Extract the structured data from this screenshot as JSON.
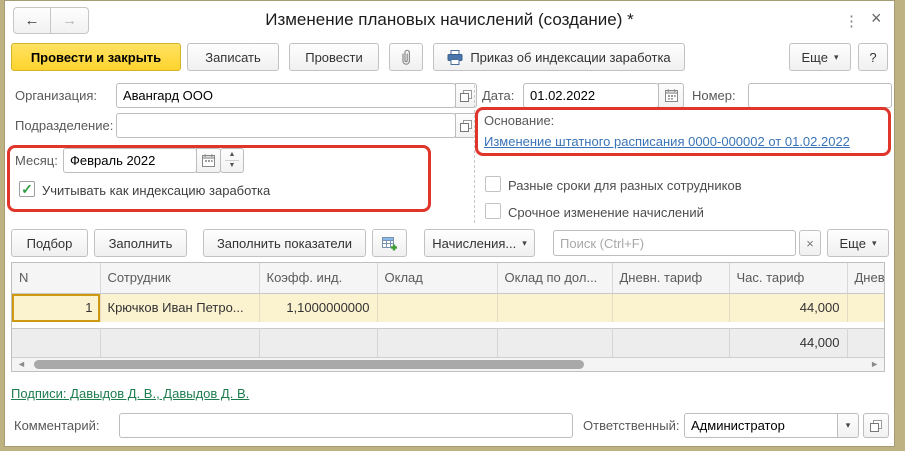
{
  "colors": {
    "accent_yellow": "#ffd42e",
    "annotation_red": "#e0352b",
    "link_blue": "#3a74b8",
    "link_green": "#1d7d4f",
    "row_highlight": "#fbf2cf",
    "selected_cell": "#f5dc6e",
    "desktop_frame": "#bfb282"
  },
  "window": {
    "title": "Изменение плановых начислений (создание) *"
  },
  "icons": {
    "back": "←",
    "forward": "→",
    "menu": "⋮",
    "close": "×",
    "dropdown": "▾",
    "spin_up": "▲",
    "spin_down": "▼",
    "check": "✓",
    "scroll_left": "◄",
    "scroll_right": "►",
    "clear": "×"
  },
  "command_bar": {
    "post_and_close": "Провести и закрыть",
    "write": "Записать",
    "post": "Провести",
    "print_order": "Приказ об индексации заработка",
    "more": "Еще",
    "help": "?"
  },
  "form": {
    "org_label": "Организация:",
    "org_value": "Авангард ООО",
    "dept_label": "Подразделение:",
    "dept_value": "",
    "date_label": "Дата:",
    "date_value": "01.02.2022",
    "number_label": "Номер:",
    "number_value": "",
    "basis_label": "Основание:",
    "basis_link": "Изменение штатного расписания 0000-000002 от 01.02.2022",
    "month_label": "Месяц:",
    "month_value": "Февраль 2022",
    "indexation_checkbox": "Учитывать как индексацию заработка",
    "diff_terms_checkbox": "Разные сроки для разных сотрудников",
    "urgent_checkbox": "Срочное изменение начислений"
  },
  "table_toolbar": {
    "pick": "Подбор",
    "fill": "Заполнить",
    "fill_indicators": "Заполнить показатели",
    "accruals": "Начисления...",
    "search_placeholder": "Поиск (Ctrl+F)",
    "more": "Еще"
  },
  "table": {
    "columns": [
      "N",
      "Сотрудник",
      "Коэфф. инд.",
      "Оклад",
      "Оклад по дол...",
      "Дневн. тариф",
      "Час. тариф",
      "Днев"
    ],
    "rows": [
      {
        "n": "1",
        "employee": "Крючков Иван Петро...",
        "coeff": "1,1000000000",
        "salary": "",
        "salary_pos": "",
        "day_rate": "",
        "hour_rate": "44,000",
        "day2": ""
      }
    ],
    "totals": {
      "hour_rate": "44,000"
    }
  },
  "footer": {
    "signatures_link": "Подписи: Давыдов Д. В., Давыдов Д. В.",
    "comment_label": "Комментарий:",
    "comment_value": "",
    "responsible_label": "Ответственный:",
    "responsible_value": "Администратор"
  }
}
